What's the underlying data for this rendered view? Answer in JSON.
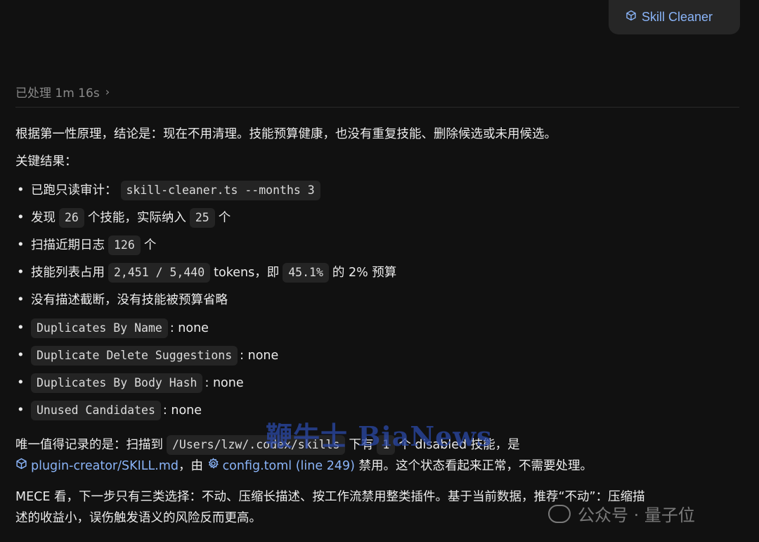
{
  "header": {
    "skill_chip_label": "Skill Cleaner",
    "processed_label": "已处理 1m 16s",
    "chevron": "›"
  },
  "content": {
    "intro": "根据第一性原理，结论是：现在不用清理。技能预算健康，也没有重复技能、删除候选或未用候选。",
    "key_results_title": "关键结果：",
    "bullets": {
      "b1_text": "已跑只读审计：",
      "b1_code": "skill-cleaner.ts --months 3",
      "b2_a": "发现",
      "b2_code1": "26",
      "b2_b": "个技能，实际纳入",
      "b2_code2": "25",
      "b2_c": "个",
      "b3_a": "扫描近期日志",
      "b3_code": "126",
      "b3_b": "个",
      "b4_a": "技能列表占用",
      "b4_code1": "2,451 / 5,440",
      "b4_b": "tokens，即",
      "b4_code2": "45.1%",
      "b4_c": "的 2% 预算",
      "b5_text": "没有描述截断，没有技能被预算省略",
      "b6_code": "Duplicates By Name",
      "b6_text": ": none",
      "b7_code": "Duplicate Delete Suggestions",
      "b7_text": ": none",
      "b8_code": "Duplicates By Body Hash",
      "b8_text": ": none",
      "b9_code": "Unused Candidates",
      "b9_text": ": none"
    },
    "note": {
      "a": "唯一值得记录的是：扫描到",
      "code1": "/Users/lzw/.codex/skills",
      "b": "下有",
      "code2": "1",
      "c": "个 disabled 技能，是",
      "link1": "plugin-creator/SKILL.md",
      "d": "，由",
      "link2": "config.toml (line 249)",
      "e": "禁用。这个状态看起来正常，不需要处理。"
    },
    "final_line1": "MECE 看，下一步只有三类选择：不动、压缩长描述、按工作流禁用整类插件。基于当前数据，推荐“不动”：压缩描",
    "final_line2": "述的收益小，误伤触发语义的风险反而更高。"
  },
  "watermarks": {
    "center": "鞭牛士 BiaNews",
    "corner": "公众号 · 量子位"
  },
  "colors": {
    "background": "#111111",
    "link": "#8ab4f8",
    "code_bg": "#242424",
    "muted": "#8a8a8a"
  },
  "icons": [
    "cube-icon",
    "chevron-right-icon",
    "gear-icon",
    "wechat-icon"
  ]
}
